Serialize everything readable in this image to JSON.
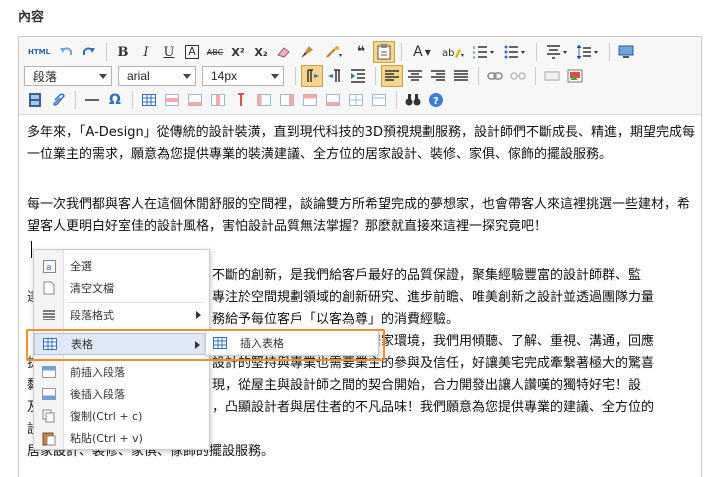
{
  "section_title": "內容",
  "toolbar": {
    "format_select": "段落",
    "font_select": "arial",
    "size_select": "14px",
    "buttons": {
      "html_label": "HTML",
      "bold": "B",
      "italic": "I",
      "underline": "U",
      "boxed_a": "A",
      "strikethrough": "ABC",
      "superscript": "X²",
      "subscript": "X₂",
      "quote": "❝",
      "font_color": "A",
      "omega": "Ω"
    }
  },
  "content": {
    "paragraphs": [
      "多年來，「A-Design」從傳統的設計裝潢，直到現代科技的3D預視規劃服務，設計師們不斷成長、精進，期望完成每一位業主的需求，願意為您提供專業的裝潢建議、全方位的居家設計、裝修、家俱、傢飾的擺設服務。",
      "每一次我們都與客人在這個休閒舒服的空間裡，談論雙方所希望完成的夢想家，也會帶客人來這裡挑選一些建材，希望客人更明白好室佳的設計風格，害怕設計品質無法掌握？那麼就直接來這裡一探究竟吧！"
    ],
    "partial_lines": [
      "不斷的創新，是我們給客戶最好的品質保證，聚集經驗豐富的設計師群、監",
      "專注於空間規劃領域的創新研究、進步前瞻、唯美創新之設計並透過團隊力量",
      "務給予每位客戶「以客為尊」的消費經驗。",
      "的貼心打造，精美、舒適的居家環境，我們用傾聽、了解、重視、溝通，回應",
      "設計的堅持與專業也需要業主的參與及信任，好讓美宅完成牽繫著極大的驚喜",
      "現，從屋主與設計師之間的契合開始，合力開發出讓人讚嘆的獨特好宅！設",
      "，凸顯設計者與居住者的不凡品味！我們願意為您提供專業的建議、全方位的",
      "居家設計、裝修、家俱、傢飾的擺設服務。"
    ],
    "left_fragments": [
      "達",
      "超",
      "拔",
      "黏",
      "及",
      "設"
    ]
  },
  "context_menu": {
    "items": [
      {
        "label": "全選",
        "icon": "select-all-icon"
      },
      {
        "label": "清空文檔",
        "icon": "clear-document-icon"
      },
      {
        "label": "段落格式",
        "icon": "paragraph-format-icon"
      },
      {
        "label": "表格",
        "icon": "table-icon"
      },
      {
        "label": "前插入段落",
        "icon": "insert-before-icon"
      },
      {
        "label": "後插入段落",
        "icon": "insert-after-icon"
      },
      {
        "label": "復制(Ctrl + c)",
        "icon": "copy-icon"
      },
      {
        "label": "粘貼(Ctrl + v)",
        "icon": "paste-icon"
      }
    ],
    "submenu": {
      "label": "插入表格",
      "icon": "insert-table-icon"
    }
  },
  "colors": {
    "highlight_border": "#ef8f2f",
    "menu_hover": "#dfe8f6",
    "toolbar_bg": "#f7f7f7",
    "link_blue": "#3b73c5",
    "red_icon": "#d9534f"
  }
}
